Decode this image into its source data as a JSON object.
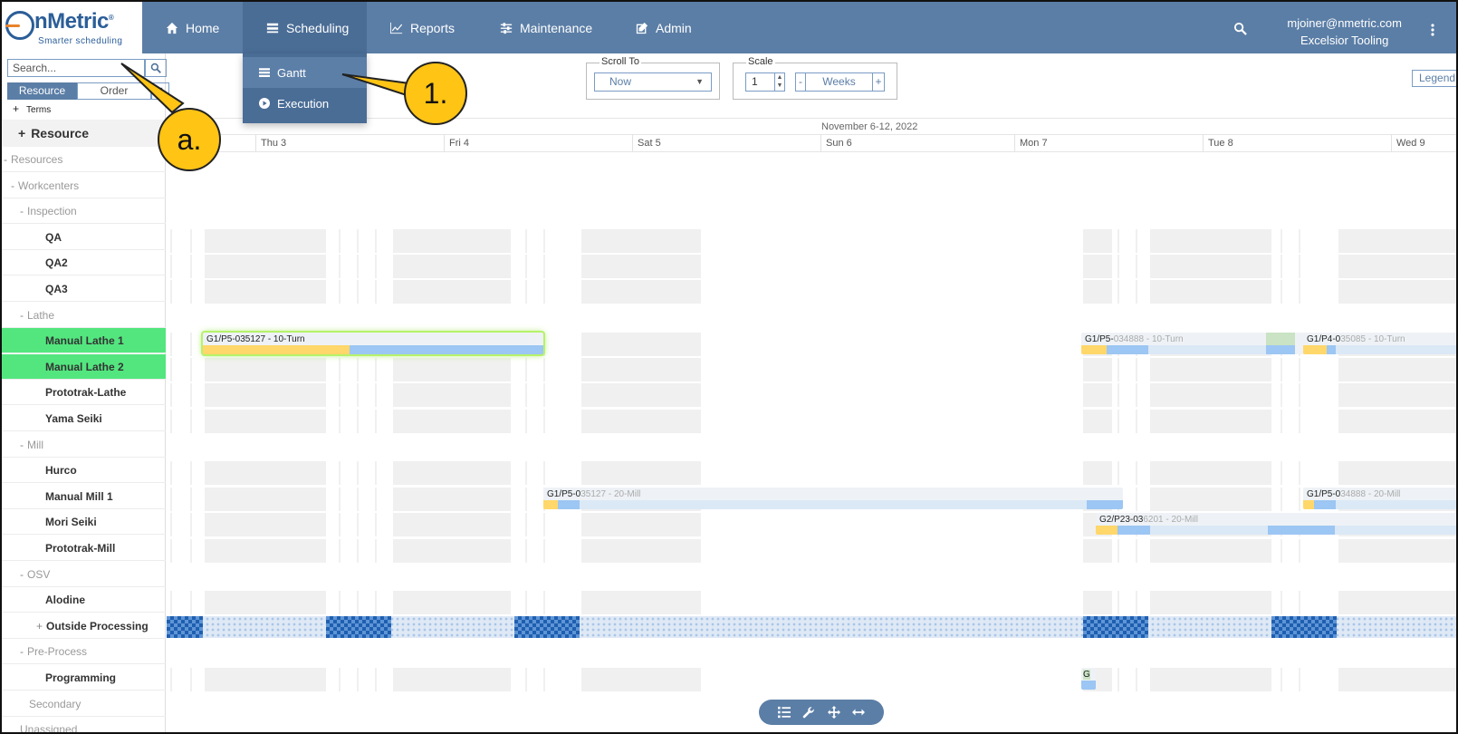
{
  "logo": {
    "brand": "nMetric",
    "registered": "®",
    "tagline": "Smarter scheduling"
  },
  "nav": {
    "items": [
      {
        "label": "Home",
        "icon": "home-icon"
      },
      {
        "label": "Scheduling",
        "icon": "scheduling-icon"
      },
      {
        "label": "Reports",
        "icon": "chart-icon"
      },
      {
        "label": "Maintenance",
        "icon": "sliders-icon"
      },
      {
        "label": "Admin",
        "icon": "edit-icon"
      }
    ],
    "user_email": "mjoiner@nmetric.com",
    "company": "Excelsior Tooling"
  },
  "scheduling_menu": {
    "items": [
      {
        "label": "Gantt"
      },
      {
        "label": "Execution"
      }
    ]
  },
  "left": {
    "search_placeholder": "Search...",
    "tabs": {
      "resource": "Resource",
      "order": "Order"
    },
    "terms": "Terms",
    "terms_toggle": "+",
    "resource_header": "Resource",
    "resource_toggle": "+",
    "tree": [
      {
        "label": "Resources",
        "prefix": "-",
        "type": "grp",
        "indent": 1
      },
      {
        "label": "Workcenters",
        "prefix": "-",
        "type": "grp",
        "indent": 2
      },
      {
        "label": "Inspection",
        "prefix": "-",
        "type": "grp",
        "indent": 3
      },
      {
        "label": "QA",
        "prefix": "",
        "type": "leaf",
        "indent": 4
      },
      {
        "label": "QA2",
        "prefix": "",
        "type": "leaf",
        "indent": 4
      },
      {
        "label": "QA3",
        "prefix": "",
        "type": "leaf",
        "indent": 4
      },
      {
        "label": "Lathe",
        "prefix": "-",
        "type": "grp",
        "indent": 3
      },
      {
        "label": "Manual Lathe 1",
        "prefix": "",
        "type": "leaf",
        "indent": 4,
        "selected": true
      },
      {
        "label": "Manual Lathe 2",
        "prefix": "",
        "type": "leaf",
        "indent": 4,
        "selected": true
      },
      {
        "label": "Prototrak-Lathe",
        "prefix": "",
        "type": "leaf",
        "indent": 4
      },
      {
        "label": "Yama Seiki",
        "prefix": "",
        "type": "leaf",
        "indent": 4
      },
      {
        "label": "Mill",
        "prefix": "-",
        "type": "grp",
        "indent": 3
      },
      {
        "label": "Hurco",
        "prefix": "",
        "type": "leaf",
        "indent": 4
      },
      {
        "label": "Manual Mill 1",
        "prefix": "",
        "type": "leaf",
        "indent": 4
      },
      {
        "label": "Mori Seiki",
        "prefix": "",
        "type": "leaf",
        "indent": 4
      },
      {
        "label": "Prototrak-Mill",
        "prefix": "",
        "type": "leaf",
        "indent": 4
      },
      {
        "label": "OSV",
        "prefix": "-",
        "type": "grp",
        "indent": 3
      },
      {
        "label": "Alodine",
        "prefix": "",
        "type": "leaf",
        "indent": 4
      },
      {
        "label": "Outside Processing",
        "prefix": "+",
        "type": "leaf",
        "indent": 4
      },
      {
        "label": "Pre-Process",
        "prefix": "-",
        "type": "grp",
        "indent": 3
      },
      {
        "label": "Programming",
        "prefix": "",
        "type": "leaf",
        "indent": 4
      },
      {
        "label": "Secondary",
        "prefix": "",
        "type": "grp",
        "indent": 3
      },
      {
        "label": "Unassigned",
        "prefix": "",
        "type": "grp",
        "indent": 2
      }
    ]
  },
  "toolbar": {
    "scroll_to_label": "Scroll To",
    "scroll_to_value": "Now",
    "scale_label": "Scale",
    "scale_value": "1",
    "scale_unit": "Weeks",
    "minus": "-",
    "plus": "+",
    "legend": "Legend"
  },
  "gantt": {
    "week": "November 6-12, 2022",
    "days": [
      "Thu 3",
      "Fri 4",
      "Sat 5",
      "Sun 6",
      "Mon 7",
      "Tue 8",
      "Wed 9"
    ],
    "jobs": [
      {
        "text": "G1/P5-035127 - 10-Turn",
        "dim": ""
      },
      {
        "text": "G1/P5-",
        "dim": "034888 - 10-Turn"
      },
      {
        "text": "G1/P4-0",
        "dim": "35085 - 10-Turn"
      },
      {
        "text": "G1/P5-0",
        "dim": "35127 - 20-Mill"
      },
      {
        "text": "G1/P5-0",
        "dim": "34888 - 20-Mill"
      },
      {
        "text": "G2/P23-03",
        "dim": "6201 - 20-Mill"
      },
      {
        "text": "G",
        "dim": ""
      }
    ]
  },
  "callouts": {
    "one": "1.",
    "a": "a."
  },
  "colors": {
    "nav": "#5b7ea6",
    "selected": "#53e67f",
    "job_yellow": "#ffd76a",
    "job_blue": "#9cc6f3",
    "callout": "#ffc414"
  }
}
